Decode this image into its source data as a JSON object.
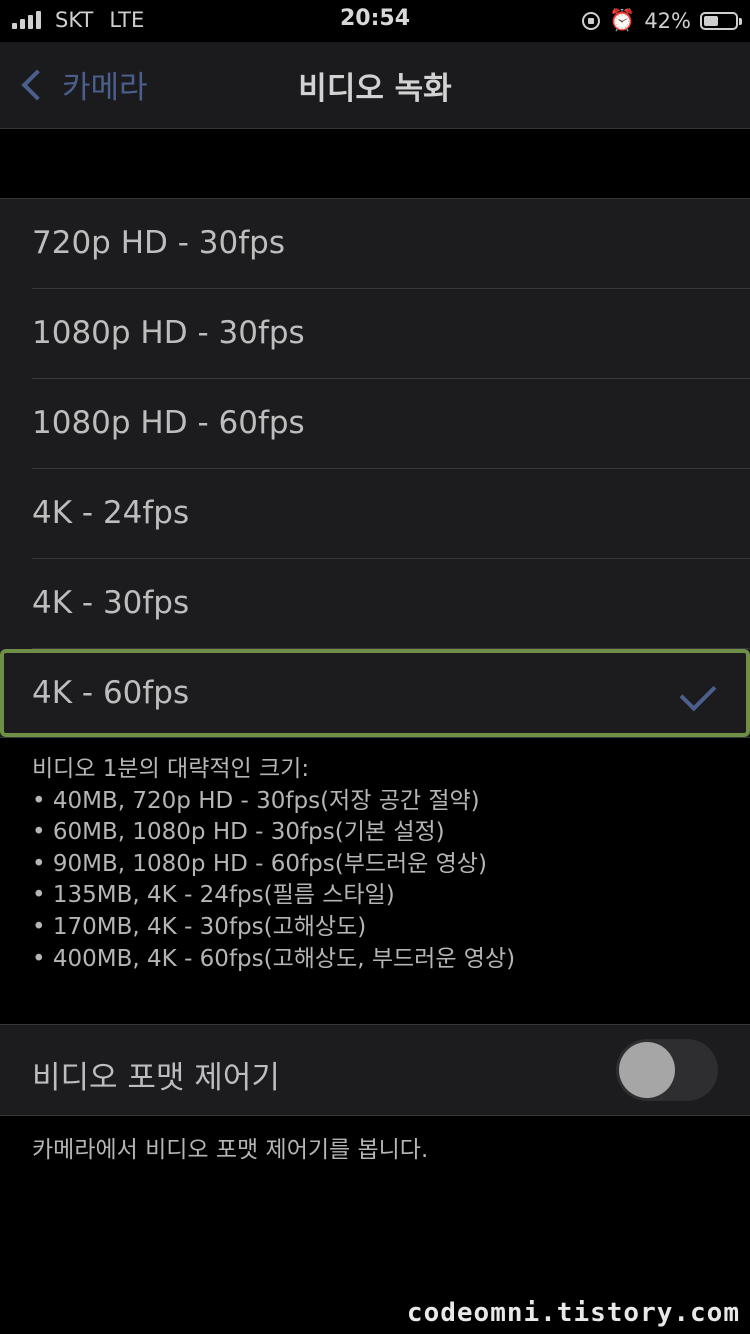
{
  "status_bar": {
    "carrier": "SKT",
    "network": "LTE",
    "time": "20:54",
    "battery_percent": "42%",
    "icons": [
      "signal-icon",
      "rotation-lock-icon",
      "alarm-icon",
      "battery-icon"
    ]
  },
  "nav": {
    "back_label": "카메라",
    "title": "비디오 녹화"
  },
  "options": [
    {
      "label": "720p HD - 30fps"
    },
    {
      "label": "1080p HD - 30fps"
    },
    {
      "label": "1080p HD - 60fps"
    },
    {
      "label": "4K - 24fps"
    },
    {
      "label": "4K - 30fps"
    },
    {
      "label": "4K - 60fps"
    }
  ],
  "selected_option": "4K - 60fps",
  "size_info": {
    "title": "비디오 1분의 대략적인 크기:",
    "items": [
      "40MB, 720p HD - 30fps(저장 공간 절약)",
      "60MB, 1080p HD - 30fps(기본 설정)",
      "90MB, 1080p HD - 60fps(부드러운 영상)",
      "135MB, 4K - 24fps(필름 스타일)",
      "170MB, 4K - 30fps(고해상도)",
      "400MB, 4K - 60fps(고해상도, 부드러운 영상)"
    ]
  },
  "format_control": {
    "label": "비디오 포맷 제어기",
    "enabled": false,
    "description": "카메라에서 비디오 포맷 제어기를 봅니다."
  },
  "watermark": "codeomni.tistory.com",
  "colors": {
    "accent": "#4a5f8c",
    "selection_outline": "#6f8f46",
    "background": "#000000",
    "group_background": "#1c1c1e"
  }
}
